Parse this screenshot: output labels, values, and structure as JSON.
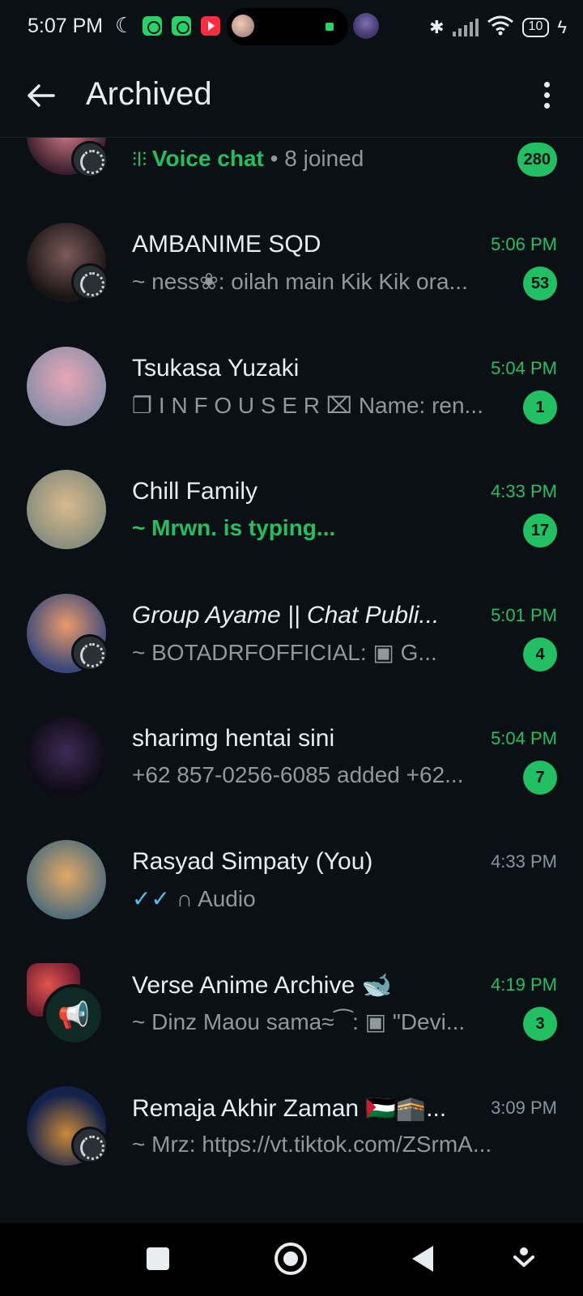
{
  "status_bar": {
    "time": "5:07 PM",
    "battery": "10",
    "icons": [
      "moon-icon",
      "whatsapp-icon",
      "whatsapp-icon",
      "youtube-icon",
      "bluetooth-icon",
      "signal-icon",
      "wifi-icon",
      "charging-icon"
    ]
  },
  "header": {
    "title": "Archived",
    "back_icon": "arrow-left-icon",
    "menu_icon": "more-vert-icon"
  },
  "chats": [
    {
      "name": "",
      "time": "",
      "preview_prefix": "Voice chat",
      "preview": " • 8 joined",
      "badge": "280",
      "has_status": true
    },
    {
      "name": "AMBANIME SQD",
      "time": "5:06 PM",
      "preview": "~ ness❀: oilah main Kik Kik ora...",
      "badge": "53",
      "has_status": true
    },
    {
      "name": "Tsukasa Yuzaki",
      "time": "5:04 PM",
      "preview": "❐ I N F O  U S E R   ⌧ Name: ren...",
      "badge": "1",
      "has_status": false
    },
    {
      "name": "Chill Family",
      "time": "4:33 PM",
      "preview": "~ Mrwn. is typing...",
      "badge": "17",
      "has_status": false
    },
    {
      "name": "Group Ayame || Chat Publi...",
      "time": "5:01 PM",
      "preview": "~ BOTADRFOFFICIAL: ▣ G...",
      "badge": "4",
      "has_status": true
    },
    {
      "name": "sharimg hentai sini",
      "time": "5:04 PM",
      "preview": "+62 857-0256-6085 added +62...",
      "badge": "7",
      "has_status": false
    },
    {
      "name": "Rasyad Simpaty (You)",
      "time": "4:33 PM",
      "preview": "✓✓ ∩ Audio",
      "badge": "",
      "has_status": false
    },
    {
      "name": "Verse Anime Archive 🐋",
      "time": "4:19 PM",
      "preview": "~ Dinz Maou sama≈⁀: ▣ \"Devi...",
      "badge": "3",
      "has_status": false
    },
    {
      "name": "Remaja Akhir Zaman 🇵🇸🕋...",
      "time": "3:09 PM",
      "preview": "~ Mrz: https://vt.tiktok.com/ZSrmA...",
      "badge": "",
      "has_status": true
    }
  ],
  "nav": {
    "recent_icon": "square-icon",
    "home_icon": "home-circle-icon",
    "back_icon": "triangle-back-icon",
    "assist_icon": "assist-icon"
  },
  "colors": {
    "background": "#0b1014",
    "accent_green": "#21c063",
    "muted_text": "#8e989d"
  }
}
